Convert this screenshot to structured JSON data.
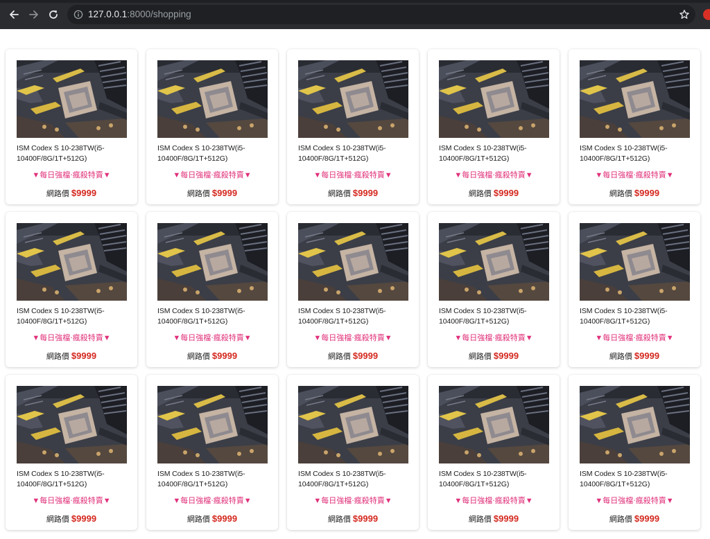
{
  "browser": {
    "url_host": "127.0.0.1",
    "url_rest": ":8000/shopping"
  },
  "icons": {
    "back": "back-arrow-icon",
    "forward": "forward-arrow-icon",
    "reload": "reload-icon",
    "info": "info-icon",
    "star": "star-icon"
  },
  "colors": {
    "promo": "#e0307a",
    "price": "#d4281e"
  },
  "products": [
    {
      "title": "ISM Codex S 10-238TW(i5-10400F/8G/1T+512G)",
      "promo": "▼每日強檔‧瘋殺特賣▼",
      "price_label": "網路價",
      "price": "$9999"
    },
    {
      "title": "ISM Codex S 10-238TW(i5-10400F/8G/1T+512G)",
      "promo": "▼每日強檔‧瘋殺特賣▼",
      "price_label": "網路價",
      "price": "$9999"
    },
    {
      "title": "ISM Codex S 10-238TW(i5-10400F/8G/1T+512G)",
      "promo": "▼每日強檔‧瘋殺特賣▼",
      "price_label": "網路價",
      "price": "$9999"
    },
    {
      "title": "ISM Codex S 10-238TW(i5-10400F/8G/1T+512G)",
      "promo": "▼每日強檔‧瘋殺特賣▼",
      "price_label": "網路價",
      "price": "$9999"
    },
    {
      "title": "ISM Codex S 10-238TW(i5-10400F/8G/1T+512G)",
      "promo": "▼每日強檔‧瘋殺特賣▼",
      "price_label": "網路價",
      "price": "$9999"
    },
    {
      "title": "ISM Codex S 10-238TW(i5-10400F/8G/1T+512G)",
      "promo": "▼每日強檔‧瘋殺特賣▼",
      "price_label": "網路價",
      "price": "$9999"
    },
    {
      "title": "ISM Codex S 10-238TW(i5-10400F/8G/1T+512G)",
      "promo": "▼每日強檔‧瘋殺特賣▼",
      "price_label": "網路價",
      "price": "$9999"
    },
    {
      "title": "ISM Codex S 10-238TW(i5-10400F/8G/1T+512G)",
      "promo": "▼每日強檔‧瘋殺特賣▼",
      "price_label": "網路價",
      "price": "$9999"
    },
    {
      "title": "ISM Codex S 10-238TW(i5-10400F/8G/1T+512G)",
      "promo": "▼每日強檔‧瘋殺特賣▼",
      "price_label": "網路價",
      "price": "$9999"
    },
    {
      "title": "ISM Codex S 10-238TW(i5-10400F/8G/1T+512G)",
      "promo": "▼每日強檔‧瘋殺特賣▼",
      "price_label": "網路價",
      "price": "$9999"
    },
    {
      "title": "ISM Codex S 10-238TW(i5-10400F/8G/1T+512G)",
      "promo": "▼每日強檔‧瘋殺特賣▼",
      "price_label": "網路價",
      "price": "$9999"
    },
    {
      "title": "ISM Codex S 10-238TW(i5-10400F/8G/1T+512G)",
      "promo": "▼每日強檔‧瘋殺特賣▼",
      "price_label": "網路價",
      "price": "$9999"
    },
    {
      "title": "ISM Codex S 10-238TW(i5-10400F/8G/1T+512G)",
      "promo": "▼每日強檔‧瘋殺特賣▼",
      "price_label": "網路價",
      "price": "$9999"
    },
    {
      "title": "ISM Codex S 10-238TW(i5-10400F/8G/1T+512G)",
      "promo": "▼每日強檔‧瘋殺特賣▼",
      "price_label": "網路價",
      "price": "$9999"
    },
    {
      "title": "ISM Codex S 10-238TW(i5-10400F/8G/1T+512G)",
      "promo": "▼每日強檔‧瘋殺特賣▼",
      "price_label": "網路價",
      "price": "$9999"
    }
  ]
}
